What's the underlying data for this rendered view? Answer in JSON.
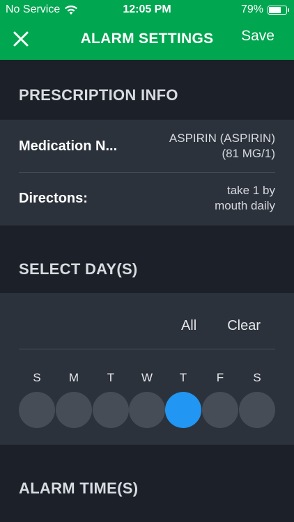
{
  "status_bar": {
    "carrier": "No Service",
    "time": "12:05 PM",
    "battery": "79%",
    "battery_level": 0.79
  },
  "nav": {
    "title": "ALARM SETTINGS",
    "save_label": "Save"
  },
  "prescription": {
    "header": "PRESCRIPTION INFO",
    "medication_label": "Medication N...",
    "medication_value_line1": "ASPIRIN (ASPIRIN)",
    "medication_value_line2": "(81 MG/1)",
    "directions_label": "Directons:",
    "directions_value_line1": "take 1 by",
    "directions_value_line2": "mouth daily"
  },
  "select_days": {
    "header": "SELECT DAY(S)",
    "all_label": "All",
    "clear_label": "Clear",
    "days": [
      {
        "letter": "S",
        "selected": false
      },
      {
        "letter": "M",
        "selected": false
      },
      {
        "letter": "T",
        "selected": false
      },
      {
        "letter": "W",
        "selected": false
      },
      {
        "letter": "T",
        "selected": true
      },
      {
        "letter": "F",
        "selected": false
      },
      {
        "letter": "S",
        "selected": false
      }
    ]
  },
  "alarm_time": {
    "header": "ALARM TIME(S)"
  },
  "colors": {
    "accent_green": "#00a650",
    "selected_day": "#2196f3"
  }
}
